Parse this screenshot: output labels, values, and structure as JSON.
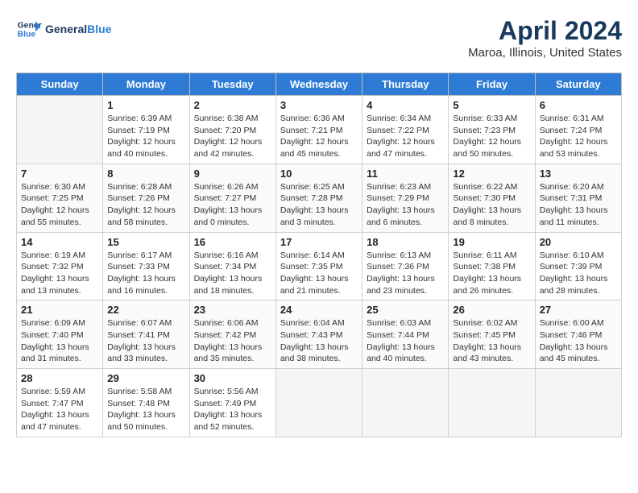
{
  "header": {
    "logo_line1": "General",
    "logo_line2": "Blue",
    "title": "April 2024",
    "subtitle": "Maroa, Illinois, United States"
  },
  "columns": [
    "Sunday",
    "Monday",
    "Tuesday",
    "Wednesday",
    "Thursday",
    "Friday",
    "Saturday"
  ],
  "weeks": [
    [
      {
        "day": "",
        "info": ""
      },
      {
        "day": "1",
        "info": "Sunrise: 6:39 AM\nSunset: 7:19 PM\nDaylight: 12 hours\nand 40 minutes."
      },
      {
        "day": "2",
        "info": "Sunrise: 6:38 AM\nSunset: 7:20 PM\nDaylight: 12 hours\nand 42 minutes."
      },
      {
        "day": "3",
        "info": "Sunrise: 6:36 AM\nSunset: 7:21 PM\nDaylight: 12 hours\nand 45 minutes."
      },
      {
        "day": "4",
        "info": "Sunrise: 6:34 AM\nSunset: 7:22 PM\nDaylight: 12 hours\nand 47 minutes."
      },
      {
        "day": "5",
        "info": "Sunrise: 6:33 AM\nSunset: 7:23 PM\nDaylight: 12 hours\nand 50 minutes."
      },
      {
        "day": "6",
        "info": "Sunrise: 6:31 AM\nSunset: 7:24 PM\nDaylight: 12 hours\nand 53 minutes."
      }
    ],
    [
      {
        "day": "7",
        "info": "Sunrise: 6:30 AM\nSunset: 7:25 PM\nDaylight: 12 hours\nand 55 minutes."
      },
      {
        "day": "8",
        "info": "Sunrise: 6:28 AM\nSunset: 7:26 PM\nDaylight: 12 hours\nand 58 minutes."
      },
      {
        "day": "9",
        "info": "Sunrise: 6:26 AM\nSunset: 7:27 PM\nDaylight: 13 hours\nand 0 minutes."
      },
      {
        "day": "10",
        "info": "Sunrise: 6:25 AM\nSunset: 7:28 PM\nDaylight: 13 hours\nand 3 minutes."
      },
      {
        "day": "11",
        "info": "Sunrise: 6:23 AM\nSunset: 7:29 PM\nDaylight: 13 hours\nand 6 minutes."
      },
      {
        "day": "12",
        "info": "Sunrise: 6:22 AM\nSunset: 7:30 PM\nDaylight: 13 hours\nand 8 minutes."
      },
      {
        "day": "13",
        "info": "Sunrise: 6:20 AM\nSunset: 7:31 PM\nDaylight: 13 hours\nand 11 minutes."
      }
    ],
    [
      {
        "day": "14",
        "info": "Sunrise: 6:19 AM\nSunset: 7:32 PM\nDaylight: 13 hours\nand 13 minutes."
      },
      {
        "day": "15",
        "info": "Sunrise: 6:17 AM\nSunset: 7:33 PM\nDaylight: 13 hours\nand 16 minutes."
      },
      {
        "day": "16",
        "info": "Sunrise: 6:16 AM\nSunset: 7:34 PM\nDaylight: 13 hours\nand 18 minutes."
      },
      {
        "day": "17",
        "info": "Sunrise: 6:14 AM\nSunset: 7:35 PM\nDaylight: 13 hours\nand 21 minutes."
      },
      {
        "day": "18",
        "info": "Sunrise: 6:13 AM\nSunset: 7:36 PM\nDaylight: 13 hours\nand 23 minutes."
      },
      {
        "day": "19",
        "info": "Sunrise: 6:11 AM\nSunset: 7:38 PM\nDaylight: 13 hours\nand 26 minutes."
      },
      {
        "day": "20",
        "info": "Sunrise: 6:10 AM\nSunset: 7:39 PM\nDaylight: 13 hours\nand 28 minutes."
      }
    ],
    [
      {
        "day": "21",
        "info": "Sunrise: 6:09 AM\nSunset: 7:40 PM\nDaylight: 13 hours\nand 31 minutes."
      },
      {
        "day": "22",
        "info": "Sunrise: 6:07 AM\nSunset: 7:41 PM\nDaylight: 13 hours\nand 33 minutes."
      },
      {
        "day": "23",
        "info": "Sunrise: 6:06 AM\nSunset: 7:42 PM\nDaylight: 13 hours\nand 35 minutes."
      },
      {
        "day": "24",
        "info": "Sunrise: 6:04 AM\nSunset: 7:43 PM\nDaylight: 13 hours\nand 38 minutes."
      },
      {
        "day": "25",
        "info": "Sunrise: 6:03 AM\nSunset: 7:44 PM\nDaylight: 13 hours\nand 40 minutes."
      },
      {
        "day": "26",
        "info": "Sunrise: 6:02 AM\nSunset: 7:45 PM\nDaylight: 13 hours\nand 43 minutes."
      },
      {
        "day": "27",
        "info": "Sunrise: 6:00 AM\nSunset: 7:46 PM\nDaylight: 13 hours\nand 45 minutes."
      }
    ],
    [
      {
        "day": "28",
        "info": "Sunrise: 5:59 AM\nSunset: 7:47 PM\nDaylight: 13 hours\nand 47 minutes."
      },
      {
        "day": "29",
        "info": "Sunrise: 5:58 AM\nSunset: 7:48 PM\nDaylight: 13 hours\nand 50 minutes."
      },
      {
        "day": "30",
        "info": "Sunrise: 5:56 AM\nSunset: 7:49 PM\nDaylight: 13 hours\nand 52 minutes."
      },
      {
        "day": "",
        "info": ""
      },
      {
        "day": "",
        "info": ""
      },
      {
        "day": "",
        "info": ""
      },
      {
        "day": "",
        "info": ""
      }
    ]
  ]
}
